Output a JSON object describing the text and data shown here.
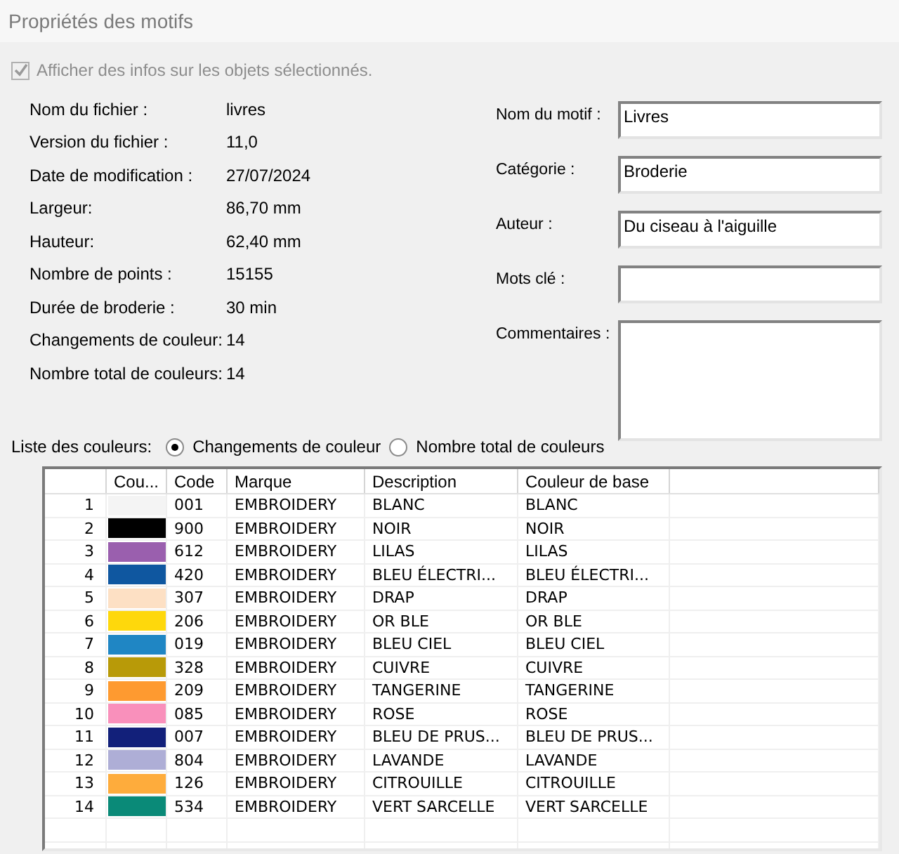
{
  "window": {
    "title": "Propriétés des motifs"
  },
  "show_info": {
    "label": "Afficher des infos sur les objets sélectionnés.",
    "checked": true,
    "disabled": true
  },
  "info": [
    {
      "label": "Nom du fichier :",
      "value": "livres"
    },
    {
      "label": "Version du fichier :",
      "value": "11,0"
    },
    {
      "label": "Date de modification :",
      "value": "27/07/2024"
    },
    {
      "label": "Largeur:",
      "value": "86,70 mm"
    },
    {
      "label": "Hauteur:",
      "value": "62,40 mm"
    },
    {
      "label": "Nombre de points :",
      "value": "15155"
    },
    {
      "label": "Durée de broderie :",
      "value": "30 min"
    },
    {
      "label": "Changements de couleur:",
      "value": "14"
    },
    {
      "label": "Nombre total de couleurs:",
      "value": "14"
    }
  ],
  "fields": [
    {
      "label": "Nom du motif :",
      "value": "Livres",
      "kind": "line"
    },
    {
      "label": "Catégorie :",
      "value": "Broderie",
      "kind": "line"
    },
    {
      "label": "Auteur :",
      "value": "Du ciseau à l'aiguille",
      "kind": "line"
    },
    {
      "label": "Mots clé :",
      "kind": "line"
    },
    {
      "label": "Commentaires :",
      "kind": "multiline"
    }
  ],
  "color_list": {
    "label": "Liste des couleurs:",
    "options": [
      {
        "label": "Changements de couleur",
        "selected": true
      },
      {
        "label": "Nombre total de couleurs",
        "selected": false
      }
    ]
  },
  "table": {
    "columns": [
      "Cou...",
      "Code",
      "Marque",
      "Description",
      "Couleur de base"
    ],
    "rows": [
      {
        "number": "1",
        "color": "#f4f4f4",
        "code": "001",
        "brand": "EMBROIDERY",
        "description": "BLANC",
        "base": "BLANC"
      },
      {
        "number": "2",
        "color": "#000000",
        "code": "900",
        "brand": "EMBROIDERY",
        "description": "NOIR",
        "base": "NOIR"
      },
      {
        "number": "3",
        "color": "#9a5fae",
        "code": "612",
        "brand": "EMBROIDERY",
        "description": "LILAS",
        "base": "LILAS"
      },
      {
        "number": "4",
        "color": "#0f57a0",
        "code": "420",
        "brand": "EMBROIDERY",
        "description": "BLEU ÉLECTRI...",
        "base": "BLEU ÉLECTRI..."
      },
      {
        "number": "5",
        "color": "#fde0c4",
        "code": "307",
        "brand": "EMBROIDERY",
        "description": "DRAP",
        "base": "DRAP"
      },
      {
        "number": "6",
        "color": "#fed80c",
        "code": "206",
        "brand": "EMBROIDERY",
        "description": "OR BLE",
        "base": "OR BLE"
      },
      {
        "number": "7",
        "color": "#1f86c4",
        "code": "019",
        "brand": "EMBROIDERY",
        "description": "BLEU CIEL",
        "base": "BLEU CIEL"
      },
      {
        "number": "8",
        "color": "#b89a08",
        "code": "328",
        "brand": "EMBROIDERY",
        "description": "CUIVRE",
        "base": "CUIVRE"
      },
      {
        "number": "9",
        "color": "#fe9a30",
        "code": "209",
        "brand": "EMBROIDERY",
        "description": "TANGERINE",
        "base": "TANGERINE"
      },
      {
        "number": "10",
        "color": "#f990bb",
        "code": "085",
        "brand": "EMBROIDERY",
        "description": "ROSE",
        "base": "ROSE"
      },
      {
        "number": "11",
        "color": "#12207a",
        "code": "007",
        "brand": "EMBROIDERY",
        "description": "BLEU DE PRUS...",
        "base": "BLEU DE PRUS..."
      },
      {
        "number": "12",
        "color": "#aeaed6",
        "code": "804",
        "brand": "EMBROIDERY",
        "description": "LAVANDE",
        "base": "LAVANDE"
      },
      {
        "number": "13",
        "color": "#feac3c",
        "code": "126",
        "brand": "EMBROIDERY",
        "description": "CITROUILLE",
        "base": "CITROUILLE"
      },
      {
        "number": "14",
        "color": "#0a8a78",
        "code": "534",
        "brand": "EMBROIDERY",
        "description": "VERT SARCELLE",
        "base": "VERT SARCELLE"
      }
    ]
  }
}
